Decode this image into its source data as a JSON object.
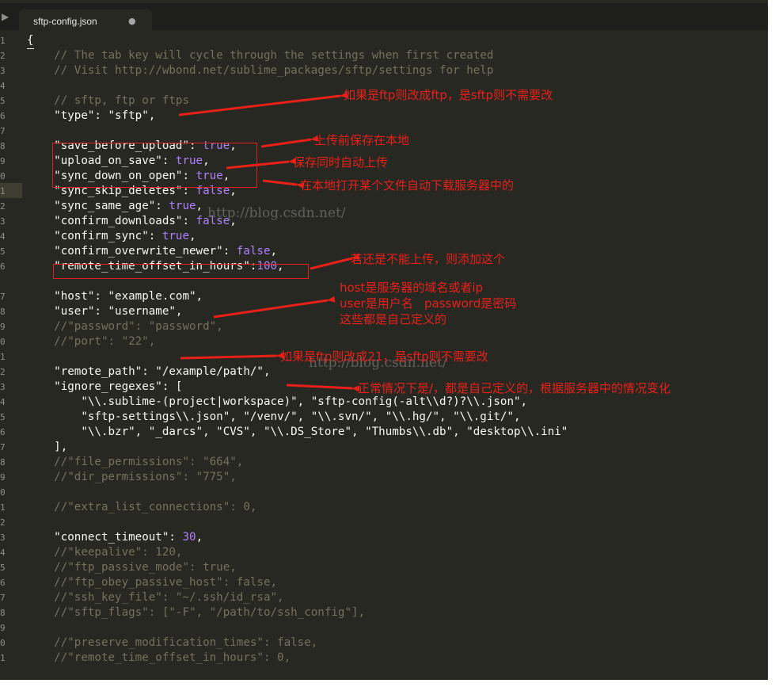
{
  "tab": {
    "filename": "sftp-config.json",
    "modified_indicator": "●",
    "sidebar_toggle": "▶"
  },
  "colors": {
    "background": "#272822",
    "comment": "#75715e",
    "string": "#f8f8f2",
    "constant": "#ae81ff",
    "annotation": "#e8201a"
  },
  "lines": [
    {
      "num": "1",
      "parts": [
        {
          "k": "s",
          "t": "{"
        }
      ]
    },
    {
      "num": "2",
      "parts": [
        {
          "k": "c",
          "t": "    // The tab key will cycle through the settings when first created"
        }
      ]
    },
    {
      "num": "3",
      "parts": [
        {
          "k": "c",
          "t": "    // Visit http://wbond.net/sublime_packages/sftp/settings for help"
        }
      ]
    },
    {
      "num": "4",
      "parts": []
    },
    {
      "num": "5",
      "parts": [
        {
          "k": "c",
          "t": "    // sftp, ftp or ftps"
        }
      ]
    },
    {
      "num": "6",
      "parts": [
        {
          "k": "s",
          "t": "    \"type\": \"sftp\","
        }
      ]
    },
    {
      "num": "7",
      "parts": []
    },
    {
      "num": "8",
      "parts": [
        {
          "k": "s",
          "t": "    \"save_before_upload\": "
        },
        {
          "k": "t",
          "t": "true"
        },
        {
          "k": "s",
          "t": ","
        }
      ]
    },
    {
      "num": "9",
      "parts": [
        {
          "k": "s",
          "t": "    \"upload_on_save\": "
        },
        {
          "k": "t",
          "t": "true"
        },
        {
          "k": "s",
          "t": ","
        }
      ]
    },
    {
      "num": "0",
      "parts": [
        {
          "k": "s",
          "t": "    \"sync_down_on_open\": "
        },
        {
          "k": "t",
          "t": "true"
        },
        {
          "k": "s",
          "t": ","
        }
      ]
    },
    {
      "num": "1",
      "parts": [
        {
          "k": "s",
          "t": "    \"sync_skip_deletes\": "
        },
        {
          "k": "t",
          "t": "false"
        },
        {
          "k": "s",
          "t": ","
        }
      ]
    },
    {
      "num": "2",
      "parts": [
        {
          "k": "s",
          "t": "    \"sync_same_age\": "
        },
        {
          "k": "t",
          "t": "true"
        },
        {
          "k": "s",
          "t": ","
        }
      ]
    },
    {
      "num": "3",
      "parts": [
        {
          "k": "s",
          "t": "    \"confirm_downloads\": "
        },
        {
          "k": "t",
          "t": "false"
        },
        {
          "k": "s",
          "t": ","
        }
      ]
    },
    {
      "num": "4",
      "parts": [
        {
          "k": "s",
          "t": "    \"confirm_sync\": "
        },
        {
          "k": "t",
          "t": "true"
        },
        {
          "k": "s",
          "t": ","
        }
      ]
    },
    {
      "num": "5",
      "parts": [
        {
          "k": "s",
          "t": "    \"confirm_overwrite_newer\": "
        },
        {
          "k": "t",
          "t": "false"
        },
        {
          "k": "s",
          "t": ","
        }
      ]
    },
    {
      "num": "6",
      "parts": [
        {
          "k": "s",
          "t": "    \"remote_time_offset_in_hours\":"
        },
        {
          "k": "n",
          "t": "100"
        },
        {
          "k": "s",
          "t": ","
        }
      ]
    },
    {
      "num": "",
      "parts": []
    },
    {
      "num": "7",
      "parts": [
        {
          "k": "s",
          "t": "    \"host\": \"example.com\","
        }
      ]
    },
    {
      "num": "8",
      "parts": [
        {
          "k": "s",
          "t": "    \"user\": \"username\","
        }
      ]
    },
    {
      "num": "9",
      "parts": [
        {
          "k": "c",
          "t": "    //\"password\": \"password\","
        }
      ]
    },
    {
      "num": "0",
      "parts": [
        {
          "k": "c",
          "t": "    //\"port\": \"22\","
        }
      ]
    },
    {
      "num": "1",
      "parts": []
    },
    {
      "num": "2",
      "parts": [
        {
          "k": "s",
          "t": "    \"remote_path\": \"/example/path/\","
        }
      ]
    },
    {
      "num": "3",
      "parts": [
        {
          "k": "s",
          "t": "    \"ignore_regexes\": ["
        }
      ]
    },
    {
      "num": "4",
      "parts": [
        {
          "k": "s",
          "t": "        \"\\\\.sublime-(project|workspace)\", \"sftp-config(-alt\\\\d?)?\\\\.json\","
        }
      ]
    },
    {
      "num": "5",
      "parts": [
        {
          "k": "s",
          "t": "        \"sftp-settings\\\\.json\", \"/venv/\", \"\\\\.svn/\", \"\\\\.hg/\", \"\\\\.git/\","
        }
      ]
    },
    {
      "num": "6",
      "parts": [
        {
          "k": "s",
          "t": "        \"\\\\.bzr\", \"_darcs\", \"CVS\", \"\\\\.DS_Store\", \"Thumbs\\\\.db\", \"desktop\\\\.ini\""
        }
      ]
    },
    {
      "num": "7",
      "parts": [
        {
          "k": "s",
          "t": "    ],"
        }
      ]
    },
    {
      "num": "8",
      "parts": [
        {
          "k": "c",
          "t": "    //\"file_permissions\": \"664\","
        }
      ]
    },
    {
      "num": "9",
      "parts": [
        {
          "k": "c",
          "t": "    //\"dir_permissions\": \"775\","
        }
      ]
    },
    {
      "num": "0",
      "parts": []
    },
    {
      "num": "1",
      "parts": [
        {
          "k": "c",
          "t": "    //\"extra_list_connections\": 0,"
        }
      ]
    },
    {
      "num": "2",
      "parts": []
    },
    {
      "num": "3",
      "parts": [
        {
          "k": "s",
          "t": "    \"connect_timeout\": "
        },
        {
          "k": "n",
          "t": "30"
        },
        {
          "k": "s",
          "t": ","
        }
      ]
    },
    {
      "num": "4",
      "parts": [
        {
          "k": "c",
          "t": "    //\"keepalive\": 120,"
        }
      ]
    },
    {
      "num": "5",
      "parts": [
        {
          "k": "c",
          "t": "    //\"ftp_passive_mode\": true,"
        }
      ]
    },
    {
      "num": "6",
      "parts": [
        {
          "k": "c",
          "t": "    //\"ftp_obey_passive_host\": false,"
        }
      ]
    },
    {
      "num": "7",
      "parts": [
        {
          "k": "c",
          "t": "    //\"ssh_key_file\": \"~/.ssh/id_rsa\","
        }
      ]
    },
    {
      "num": "8",
      "parts": [
        {
          "k": "c",
          "t": "    //\"sftp_flags\": [\"-F\", \"/path/to/ssh_config\"],"
        }
      ]
    },
    {
      "num": "9",
      "parts": []
    },
    {
      "num": "0",
      "parts": [
        {
          "k": "c",
          "t": "    //\"preserve_modification_times\": false,"
        }
      ]
    },
    {
      "num": "1",
      "parts": [
        {
          "k": "c",
          "t": "    //\"remote_time_offset_in_hours\": 0,"
        }
      ]
    }
  ],
  "annotations": {
    "type_note": "如果是ftp则改成ftp，是sftp则不需要改",
    "save_before_upload_note": "上传前保存在本地",
    "upload_on_save_note": "保存同时自动上传",
    "sync_down_note": "在本地打开某个文件自动下载服务器中的",
    "offset_note": "若还是不能上传，则添加这个",
    "host_note_1": "host是服务器的域名或者ip",
    "host_note_2": "user是用户名   password是密码",
    "host_note_3": "这些都是自己定义的",
    "port_note": "如果是ftp则改成21，是sftp则不需要改",
    "remote_path_note": "正常情况下是/，都是自己定义的，根据服务器中的情况变化"
  },
  "watermarks": {
    "first": "http://blog.csdn.net/",
    "second": "http://blog.csdn.net/"
  }
}
